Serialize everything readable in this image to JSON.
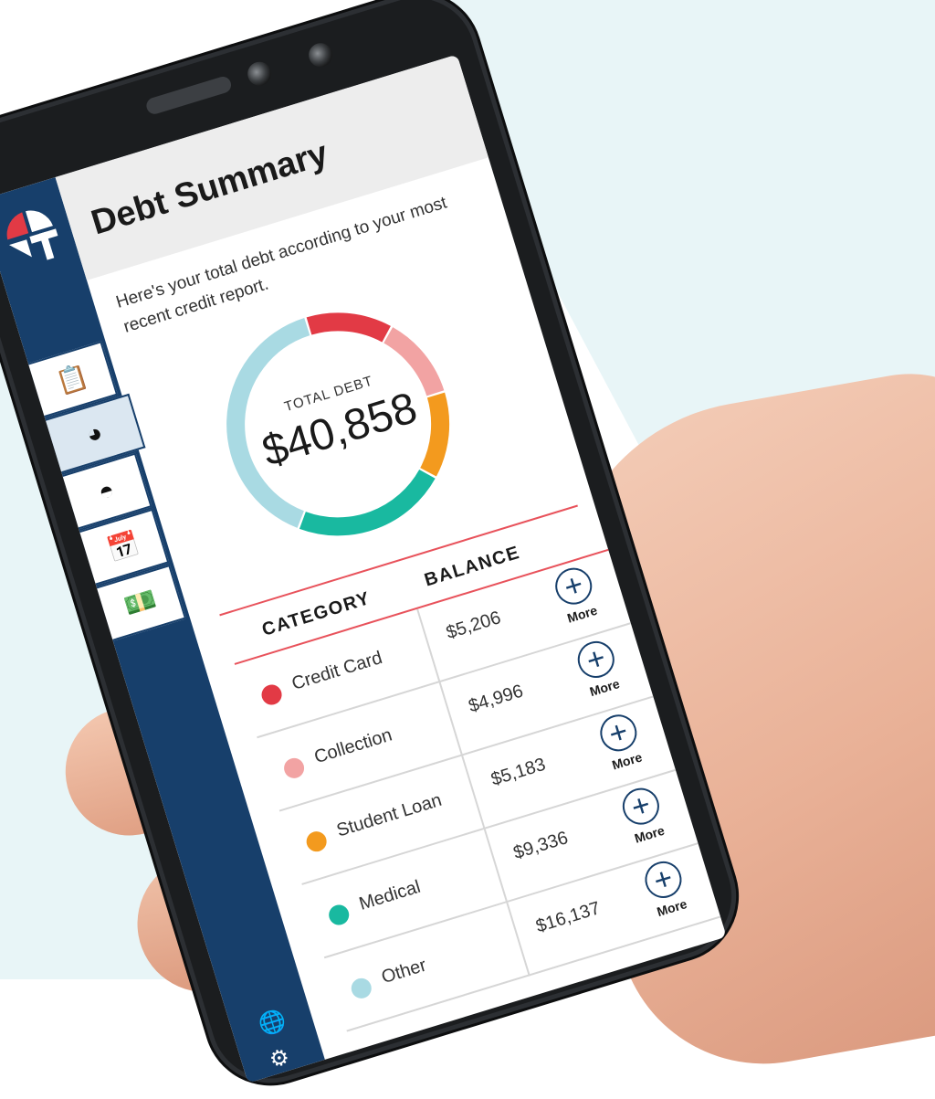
{
  "app": {
    "title": "Debt Summary",
    "intro": "Here's your total debt according to your most recent credit report."
  },
  "sidebar": {
    "items": [
      {
        "icon": "clipboard-check-icon",
        "glyph": "📋"
      },
      {
        "icon": "pie-chart-icon",
        "glyph": "◕",
        "active": true
      },
      {
        "icon": "speedometer-icon",
        "glyph": "◓"
      },
      {
        "icon": "calendar-icon",
        "glyph": "📅"
      },
      {
        "icon": "money-bill-icon",
        "glyph": "💵"
      }
    ],
    "bottom_icons": [
      "globe-icon",
      "gear-icon"
    ]
  },
  "summary": {
    "label": "TOTAL DEBT",
    "total": "$40,858"
  },
  "table": {
    "headers": {
      "category": "CATEGORY",
      "balance": "BALANCE"
    },
    "more_label": "More",
    "rows": [
      {
        "category": "Credit Card",
        "balance": "$5,206",
        "color": "#e23a45",
        "value": 5206
      },
      {
        "category": "Collection",
        "balance": "$4,996",
        "color": "#f2a3a3",
        "value": 4996
      },
      {
        "category": "Student Loan",
        "balance": "$5,183",
        "color": "#f39a1e",
        "value": 5183
      },
      {
        "category": "Medical",
        "balance": "$9,336",
        "color": "#19b9a0",
        "value": 9336
      },
      {
        "category": "Other",
        "balance": "$16,137",
        "color": "#a9dae3",
        "value": 16137
      }
    ]
  },
  "colors": {
    "sidebar": "#173f6b",
    "accent_red": "#e8525b",
    "background": "#e8f5f7"
  }
}
